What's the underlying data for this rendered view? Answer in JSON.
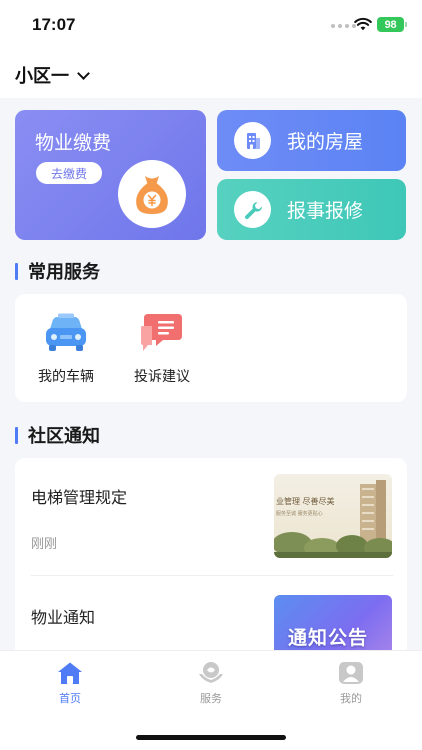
{
  "status_bar": {
    "time": "17:07",
    "battery": "98"
  },
  "header": {
    "community": "小区一"
  },
  "cards": {
    "fee": {
      "title": "物业缴费",
      "button": "去缴费"
    },
    "house": {
      "label": "我的房屋"
    },
    "repair": {
      "label": "报事报修"
    }
  },
  "services": {
    "title": "常用服务",
    "items": [
      {
        "label": "我的车辆",
        "icon": "car-icon"
      },
      {
        "label": "投诉建议",
        "icon": "complaint-icon"
      }
    ]
  },
  "notices": {
    "title": "社区通知",
    "items": [
      {
        "title": "电梯管理规定",
        "time": "刚刚",
        "thumb_text": "业管理  尽善尽美",
        "thumb_subtext": "服务至诚  服务更贴心"
      },
      {
        "title": "物业通知",
        "thumb_text": "通知公告"
      }
    ]
  },
  "tabs": [
    {
      "label": "首页",
      "active": true
    },
    {
      "label": "服务",
      "active": false
    },
    {
      "label": "我的",
      "active": false
    }
  ],
  "colors": {
    "accent": "#4f7cf5",
    "fee_card": "#7a7ff0",
    "house_card": "#5f87f5",
    "repair_card": "#48cbba",
    "money_bag": "#f59a4a"
  }
}
